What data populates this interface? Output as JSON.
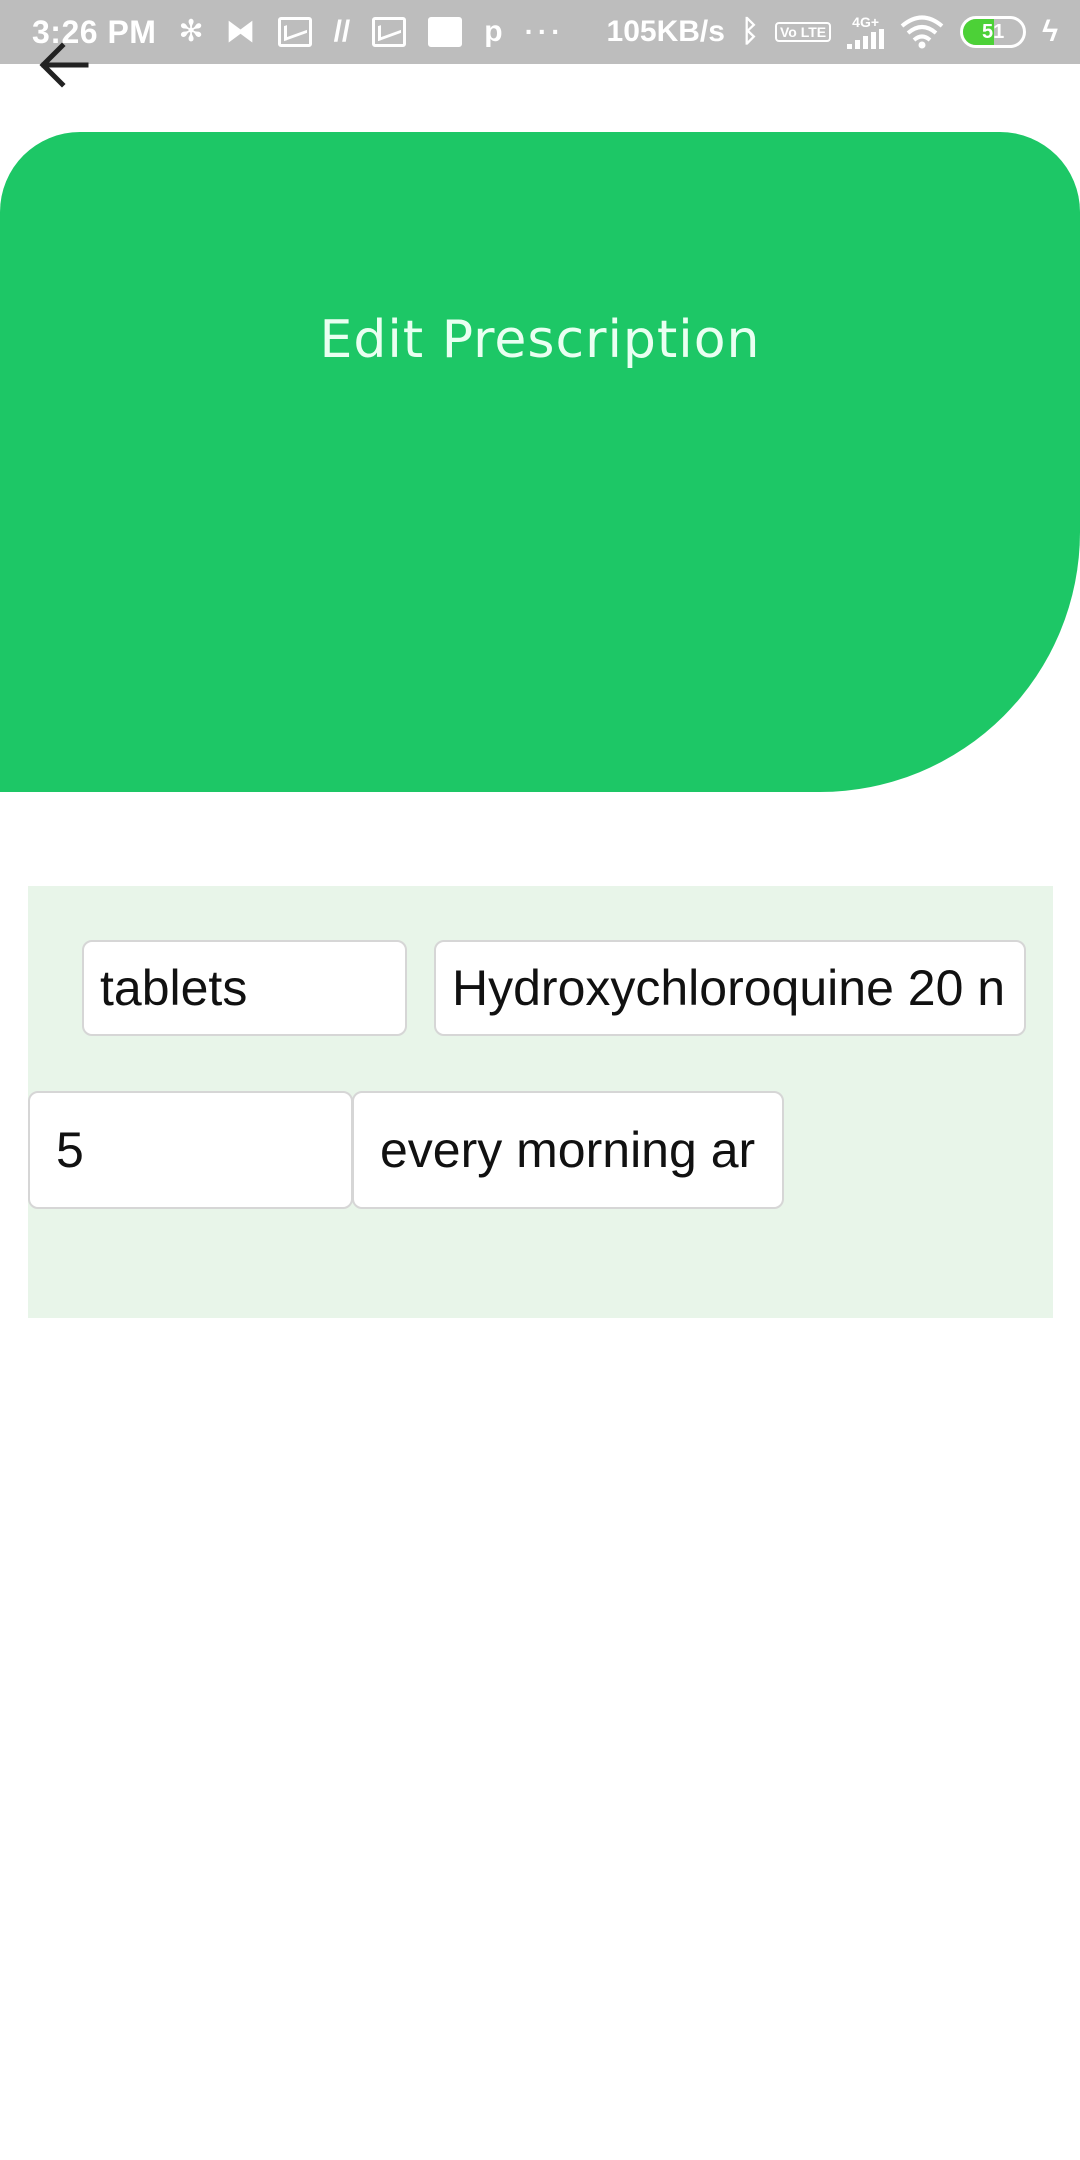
{
  "status_bar": {
    "time": "3:26 PM",
    "network_speed": "105KB/s",
    "volte": "Vo LTE",
    "network_type": "4G+",
    "battery_level": "51",
    "notification_icons": [
      "slack-icon",
      "squarespace-icon",
      "gmail-icon",
      "n-icon",
      "gmail-icon",
      "square-icon",
      "p-icon"
    ],
    "overflow": "···"
  },
  "header": {
    "title": "Edit Prescription",
    "color": "#1dc766"
  },
  "form": {
    "panel_color": "#e8f5e9",
    "unit": "tablets",
    "drug_name": "Hydroxychloroquine 20 n",
    "quantity": "5",
    "frequency": "every morning ar"
  }
}
